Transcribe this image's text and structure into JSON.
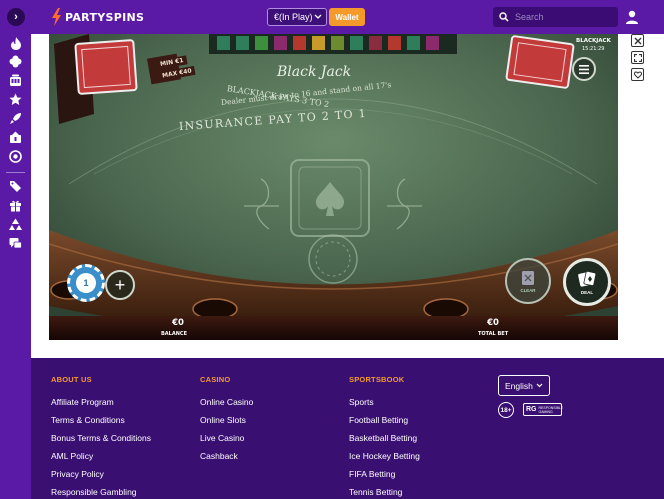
{
  "header": {
    "logo_text": "PARTYSPINS",
    "balance_select": "€(In Play)",
    "wallet_label": "Wallet",
    "search_placeholder": "Search"
  },
  "sidebar": {
    "items": [
      {
        "icon": "fire-icon"
      },
      {
        "icon": "clover-icon"
      },
      {
        "icon": "slot-machine-icon"
      },
      {
        "icon": "star-icon"
      },
      {
        "icon": "rocket-icon"
      },
      {
        "icon": "jackpot-icon"
      },
      {
        "icon": "roulette-icon"
      },
      {
        "icon": "promo-icon"
      },
      {
        "icon": "gift-icon"
      },
      {
        "icon": "community-icon"
      },
      {
        "icon": "chat-icon"
      }
    ]
  },
  "game": {
    "title": "Black Jack",
    "rule_line1": "BLACKJACK PAYS 3 TO 2",
    "rule_line2": "Dealer must draw to 16 and stand on all 17's",
    "insurance": "INSURANCE PAY TO 2 TO 1",
    "min_bet": "MIN €1",
    "max_bet": "MAX €40",
    "game_label": "BLACKJACK",
    "clock": "15:21:29",
    "chip_value": "1",
    "clear_label": "CLEAR",
    "deal_label": "DEAL",
    "balance_value": "€0",
    "balance_label": "BALANCE",
    "total_bet_value": "€0",
    "total_bet_label": "TOTAL BET"
  },
  "footer": {
    "columns": [
      {
        "heading": "ABOUT US",
        "links": [
          "Affiliate Program",
          "Terms & Conditions",
          "Bonus Terms & Conditions",
          "AML Policy",
          "Privacy Policy",
          "Responsible Gambling"
        ]
      },
      {
        "heading": "CASINO",
        "links": [
          "Online Casino",
          "Online Slots",
          "Live Casino",
          "Cashback"
        ]
      },
      {
        "heading": "SPORTSBOOK",
        "links": [
          "Sports",
          "Football Betting",
          "Basketball Betting",
          "Ice Hockey Betting",
          "FIFA Betting",
          "Tennis Betting"
        ]
      }
    ],
    "language": "English",
    "age_badge": "18+",
    "rg_badge": "RG",
    "rg_text_1": "RESPONSIBLE",
    "rg_text_2": "GAMING"
  },
  "colors": {
    "brand_purple": "#5b1aa6",
    "footer_purple": "#3a0f72",
    "accent_orange": "#f39a2b",
    "felt_green": "#4f6a52"
  }
}
